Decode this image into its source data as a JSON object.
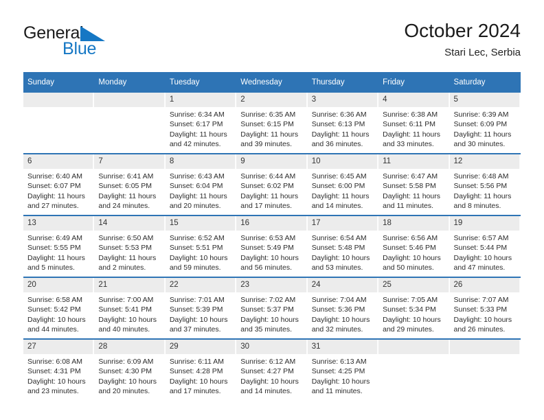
{
  "brand": {
    "name_part1": "General",
    "name_part2": "Blue",
    "logo_icon": "blue-triangle-icon",
    "color_dark": "#1b1b1b",
    "color_blue": "#1577c4"
  },
  "header": {
    "title": "October 2024",
    "location": "Stari Lec, Serbia"
  },
  "theme": {
    "header_blue": "#2e74b5",
    "daynum_background": "#ececec",
    "cell_background": "#ffffff",
    "text_color": "#2b2b2b"
  },
  "calendar": {
    "weekday_headers": [
      "Sunday",
      "Monday",
      "Tuesday",
      "Wednesday",
      "Thursday",
      "Friday",
      "Saturday"
    ],
    "labels": {
      "sunrise": "Sunrise:",
      "sunset": "Sunset:",
      "daylight": "Daylight:"
    },
    "weeks": [
      [
        {
          "day": "",
          "sunrise": "",
          "sunset": "",
          "daylight_line1": "",
          "daylight_line2": "",
          "empty": true
        },
        {
          "day": "",
          "sunrise": "",
          "sunset": "",
          "daylight_line1": "",
          "daylight_line2": "",
          "empty": true
        },
        {
          "day": "1",
          "sunrise": "Sunrise: 6:34 AM",
          "sunset": "Sunset: 6:17 PM",
          "daylight_line1": "Daylight: 11 hours",
          "daylight_line2": "and 42 minutes."
        },
        {
          "day": "2",
          "sunrise": "Sunrise: 6:35 AM",
          "sunset": "Sunset: 6:15 PM",
          "daylight_line1": "Daylight: 11 hours",
          "daylight_line2": "and 39 minutes."
        },
        {
          "day": "3",
          "sunrise": "Sunrise: 6:36 AM",
          "sunset": "Sunset: 6:13 PM",
          "daylight_line1": "Daylight: 11 hours",
          "daylight_line2": "and 36 minutes."
        },
        {
          "day": "4",
          "sunrise": "Sunrise: 6:38 AM",
          "sunset": "Sunset: 6:11 PM",
          "daylight_line1": "Daylight: 11 hours",
          "daylight_line2": "and 33 minutes."
        },
        {
          "day": "5",
          "sunrise": "Sunrise: 6:39 AM",
          "sunset": "Sunset: 6:09 PM",
          "daylight_line1": "Daylight: 11 hours",
          "daylight_line2": "and 30 minutes."
        }
      ],
      [
        {
          "day": "6",
          "sunrise": "Sunrise: 6:40 AM",
          "sunset": "Sunset: 6:07 PM",
          "daylight_line1": "Daylight: 11 hours",
          "daylight_line2": "and 27 minutes."
        },
        {
          "day": "7",
          "sunrise": "Sunrise: 6:41 AM",
          "sunset": "Sunset: 6:05 PM",
          "daylight_line1": "Daylight: 11 hours",
          "daylight_line2": "and 24 minutes."
        },
        {
          "day": "8",
          "sunrise": "Sunrise: 6:43 AM",
          "sunset": "Sunset: 6:04 PM",
          "daylight_line1": "Daylight: 11 hours",
          "daylight_line2": "and 20 minutes."
        },
        {
          "day": "9",
          "sunrise": "Sunrise: 6:44 AM",
          "sunset": "Sunset: 6:02 PM",
          "daylight_line1": "Daylight: 11 hours",
          "daylight_line2": "and 17 minutes."
        },
        {
          "day": "10",
          "sunrise": "Sunrise: 6:45 AM",
          "sunset": "Sunset: 6:00 PM",
          "daylight_line1": "Daylight: 11 hours",
          "daylight_line2": "and 14 minutes."
        },
        {
          "day": "11",
          "sunrise": "Sunrise: 6:47 AM",
          "sunset": "Sunset: 5:58 PM",
          "daylight_line1": "Daylight: 11 hours",
          "daylight_line2": "and 11 minutes."
        },
        {
          "day": "12",
          "sunrise": "Sunrise: 6:48 AM",
          "sunset": "Sunset: 5:56 PM",
          "daylight_line1": "Daylight: 11 hours",
          "daylight_line2": "and 8 minutes."
        }
      ],
      [
        {
          "day": "13",
          "sunrise": "Sunrise: 6:49 AM",
          "sunset": "Sunset: 5:55 PM",
          "daylight_line1": "Daylight: 11 hours",
          "daylight_line2": "and 5 minutes."
        },
        {
          "day": "14",
          "sunrise": "Sunrise: 6:50 AM",
          "sunset": "Sunset: 5:53 PM",
          "daylight_line1": "Daylight: 11 hours",
          "daylight_line2": "and 2 minutes."
        },
        {
          "day": "15",
          "sunrise": "Sunrise: 6:52 AM",
          "sunset": "Sunset: 5:51 PM",
          "daylight_line1": "Daylight: 10 hours",
          "daylight_line2": "and 59 minutes."
        },
        {
          "day": "16",
          "sunrise": "Sunrise: 6:53 AM",
          "sunset": "Sunset: 5:49 PM",
          "daylight_line1": "Daylight: 10 hours",
          "daylight_line2": "and 56 minutes."
        },
        {
          "day": "17",
          "sunrise": "Sunrise: 6:54 AM",
          "sunset": "Sunset: 5:48 PM",
          "daylight_line1": "Daylight: 10 hours",
          "daylight_line2": "and 53 minutes."
        },
        {
          "day": "18",
          "sunrise": "Sunrise: 6:56 AM",
          "sunset": "Sunset: 5:46 PM",
          "daylight_line1": "Daylight: 10 hours",
          "daylight_line2": "and 50 minutes."
        },
        {
          "day": "19",
          "sunrise": "Sunrise: 6:57 AM",
          "sunset": "Sunset: 5:44 PM",
          "daylight_line1": "Daylight: 10 hours",
          "daylight_line2": "and 47 minutes."
        }
      ],
      [
        {
          "day": "20",
          "sunrise": "Sunrise: 6:58 AM",
          "sunset": "Sunset: 5:42 PM",
          "daylight_line1": "Daylight: 10 hours",
          "daylight_line2": "and 44 minutes."
        },
        {
          "day": "21",
          "sunrise": "Sunrise: 7:00 AM",
          "sunset": "Sunset: 5:41 PM",
          "daylight_line1": "Daylight: 10 hours",
          "daylight_line2": "and 40 minutes."
        },
        {
          "day": "22",
          "sunrise": "Sunrise: 7:01 AM",
          "sunset": "Sunset: 5:39 PM",
          "daylight_line1": "Daylight: 10 hours",
          "daylight_line2": "and 37 minutes."
        },
        {
          "day": "23",
          "sunrise": "Sunrise: 7:02 AM",
          "sunset": "Sunset: 5:37 PM",
          "daylight_line1": "Daylight: 10 hours",
          "daylight_line2": "and 35 minutes."
        },
        {
          "day": "24",
          "sunrise": "Sunrise: 7:04 AM",
          "sunset": "Sunset: 5:36 PM",
          "daylight_line1": "Daylight: 10 hours",
          "daylight_line2": "and 32 minutes."
        },
        {
          "day": "25",
          "sunrise": "Sunrise: 7:05 AM",
          "sunset": "Sunset: 5:34 PM",
          "daylight_line1": "Daylight: 10 hours",
          "daylight_line2": "and 29 minutes."
        },
        {
          "day": "26",
          "sunrise": "Sunrise: 7:07 AM",
          "sunset": "Sunset: 5:33 PM",
          "daylight_line1": "Daylight: 10 hours",
          "daylight_line2": "and 26 minutes."
        }
      ],
      [
        {
          "day": "27",
          "sunrise": "Sunrise: 6:08 AM",
          "sunset": "Sunset: 4:31 PM",
          "daylight_line1": "Daylight: 10 hours",
          "daylight_line2": "and 23 minutes."
        },
        {
          "day": "28",
          "sunrise": "Sunrise: 6:09 AM",
          "sunset": "Sunset: 4:30 PM",
          "daylight_line1": "Daylight: 10 hours",
          "daylight_line2": "and 20 minutes."
        },
        {
          "day": "29",
          "sunrise": "Sunrise: 6:11 AM",
          "sunset": "Sunset: 4:28 PM",
          "daylight_line1": "Daylight: 10 hours",
          "daylight_line2": "and 17 minutes."
        },
        {
          "day": "30",
          "sunrise": "Sunrise: 6:12 AM",
          "sunset": "Sunset: 4:27 PM",
          "daylight_line1": "Daylight: 10 hours",
          "daylight_line2": "and 14 minutes."
        },
        {
          "day": "31",
          "sunrise": "Sunrise: 6:13 AM",
          "sunset": "Sunset: 4:25 PM",
          "daylight_line1": "Daylight: 10 hours",
          "daylight_line2": "and 11 minutes."
        },
        {
          "day": "",
          "sunrise": "",
          "sunset": "",
          "daylight_line1": "",
          "daylight_line2": "",
          "empty": true
        },
        {
          "day": "",
          "sunrise": "",
          "sunset": "",
          "daylight_line1": "",
          "daylight_line2": "",
          "empty": true
        }
      ]
    ]
  }
}
